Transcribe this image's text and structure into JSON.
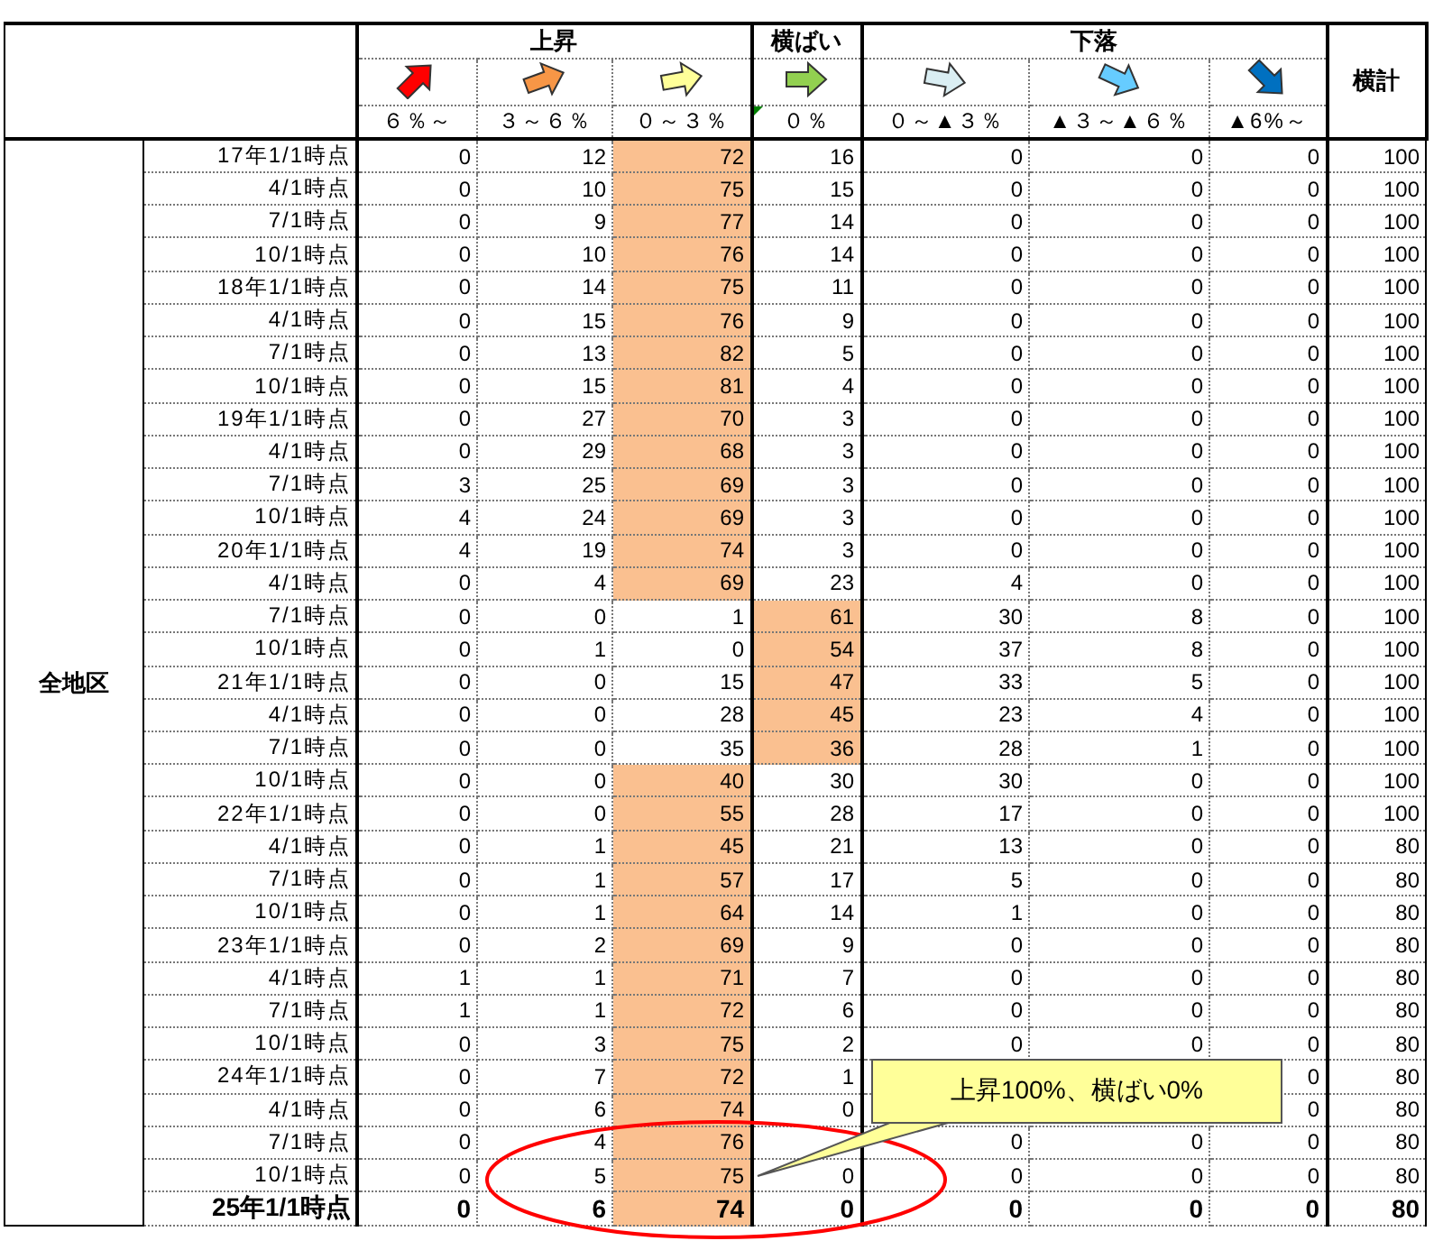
{
  "groups": [
    {
      "label": "上昇",
      "columns": [
        {
          "label": "６％～",
          "color": "#ff0000"
        },
        {
          "label": "３～６％",
          "color": "#f79646"
        },
        {
          "label": "０～３％",
          "color": "#ffff99"
        }
      ]
    },
    {
      "label": "横ばい",
      "columns": [
        {
          "label": "０％",
          "color": "#92d050"
        }
      ]
    },
    {
      "label": "下落",
      "columns": [
        {
          "label": "０～▲３％",
          "color": "#daeef3"
        },
        {
          "label": "▲３～▲６％",
          "color": "#66ccff"
        },
        {
          "label": "▲6%～",
          "color": "#0070c0"
        }
      ]
    }
  ],
  "total_header": "横計",
  "region": "全地区",
  "rows": [
    {
      "label": "17年1/1時点",
      "values": [
        "0",
        "12",
        "72",
        "16",
        "0",
        "0",
        "0"
      ],
      "total": "100",
      "flat_highlighted": false,
      "emphasis": false,
      "kind": "full"
    },
    {
      "label": "4/1時点",
      "values": [
        "0",
        "10",
        "75",
        "15",
        "0",
        "0",
        "0"
      ],
      "total": "100",
      "flat_highlighted": false,
      "emphasis": false,
      "kind": "full"
    },
    {
      "label": "7/1時点",
      "values": [
        "0",
        "9",
        "77",
        "14",
        "0",
        "0",
        "0"
      ],
      "total": "100",
      "flat_highlighted": false,
      "emphasis": false,
      "kind": "full"
    },
    {
      "label": "10/1時点",
      "values": [
        "0",
        "10",
        "76",
        "14",
        "0",
        "0",
        "0"
      ],
      "total": "100",
      "flat_highlighted": false,
      "emphasis": false,
      "kind": "full"
    },
    {
      "label": "18年1/1時点",
      "values": [
        "0",
        "14",
        "75",
        "11",
        "0",
        "0",
        "0"
      ],
      "total": "100",
      "flat_highlighted": false,
      "emphasis": false,
      "kind": "full"
    },
    {
      "label": "4/1時点",
      "values": [
        "0",
        "15",
        "76",
        "9",
        "0",
        "0",
        "0"
      ],
      "total": "100",
      "flat_highlighted": false,
      "emphasis": false,
      "kind": "full"
    },
    {
      "label": "7/1時点",
      "values": [
        "0",
        "13",
        "82",
        "5",
        "0",
        "0",
        "0"
      ],
      "total": "100",
      "flat_highlighted": false,
      "emphasis": false,
      "kind": "full"
    },
    {
      "label": "10/1時点",
      "values": [
        "0",
        "15",
        "81",
        "4",
        "0",
        "0",
        "0"
      ],
      "total": "100",
      "flat_highlighted": false,
      "emphasis": false,
      "kind": "full"
    },
    {
      "label": "19年1/1時点",
      "values": [
        "0",
        "27",
        "70",
        "3",
        "0",
        "0",
        "0"
      ],
      "total": "100",
      "flat_highlighted": false,
      "emphasis": false,
      "kind": "full"
    },
    {
      "label": "4/1時点",
      "values": [
        "0",
        "29",
        "68",
        "3",
        "0",
        "0",
        "0"
      ],
      "total": "100",
      "flat_highlighted": false,
      "emphasis": false,
      "kind": "full"
    },
    {
      "label": "7/1時点",
      "values": [
        "3",
        "25",
        "69",
        "3",
        "0",
        "0",
        "0"
      ],
      "total": "100",
      "flat_highlighted": false,
      "emphasis": false,
      "kind": "full"
    },
    {
      "label": "10/1時点",
      "values": [
        "4",
        "24",
        "69",
        "3",
        "0",
        "0",
        "0"
      ],
      "total": "100",
      "flat_highlighted": false,
      "emphasis": false,
      "kind": "full"
    },
    {
      "label": "20年1/1時点",
      "values": [
        "4",
        "19",
        "74",
        "3",
        "0",
        "0",
        "0"
      ],
      "total": "100",
      "flat_highlighted": false,
      "emphasis": false,
      "kind": "full"
    },
    {
      "label": "4/1時点",
      "values": [
        "0",
        "4",
        "69",
        "23",
        "4",
        "0",
        "0"
      ],
      "total": "100",
      "flat_highlighted": false,
      "emphasis": false,
      "kind": "full"
    },
    {
      "label": "7/1時点",
      "values": [
        "0",
        "0",
        "1",
        "61",
        "30",
        "8",
        "0"
      ],
      "total": "100",
      "flat_highlighted": true,
      "emphasis": false,
      "kind": "full"
    },
    {
      "label": "10/1時点",
      "values": [
        "0",
        "1",
        "0",
        "54",
        "37",
        "8",
        "0"
      ],
      "total": "100",
      "flat_highlighted": true,
      "emphasis": false,
      "kind": "full"
    },
    {
      "label": "21年1/1時点",
      "values": [
        "0",
        "0",
        "15",
        "47",
        "33",
        "5",
        "0"
      ],
      "total": "100",
      "flat_highlighted": true,
      "emphasis": false,
      "kind": "full"
    },
    {
      "label": "4/1時点",
      "values": [
        "0",
        "0",
        "28",
        "45",
        "23",
        "4",
        "0"
      ],
      "total": "100",
      "flat_highlighted": true,
      "emphasis": false,
      "kind": "full"
    },
    {
      "label": "7/1時点",
      "values": [
        "0",
        "0",
        "35",
        "36",
        "28",
        "1",
        "0"
      ],
      "total": "100",
      "flat_highlighted": true,
      "emphasis": false,
      "kind": "full"
    },
    {
      "label": "10/1時点",
      "values": [
        "0",
        "0",
        "40",
        "30",
        "30",
        "0",
        "0"
      ],
      "total": "100",
      "flat_highlighted": false,
      "emphasis": false,
      "kind": "full"
    },
    {
      "label": "22年1/1時点",
      "values": [
        "0",
        "0",
        "55",
        "28",
        "17",
        "0",
        "0"
      ],
      "total": "100",
      "flat_highlighted": false,
      "emphasis": false,
      "kind": "full"
    },
    {
      "label": "4/1時点",
      "values": [
        "0",
        "1",
        "45",
        "21",
        "13",
        "0",
        "0"
      ],
      "total": "80",
      "flat_highlighted": false,
      "emphasis": false,
      "kind": "full"
    },
    {
      "label": "7/1時点",
      "values": [
        "0",
        "1",
        "57",
        "17",
        "5",
        "0",
        "0"
      ],
      "total": "80",
      "flat_highlighted": false,
      "emphasis": false,
      "kind": "full"
    },
    {
      "label": "10/1時点",
      "values": [
        "0",
        "1",
        "64",
        "14",
        "1",
        "0",
        "0"
      ],
      "total": "80",
      "flat_highlighted": false,
      "emphasis": false,
      "kind": "full"
    },
    {
      "label": "23年1/1時点",
      "values": [
        "0",
        "2",
        "69",
        "9",
        "0",
        "0",
        "0"
      ],
      "total": "80",
      "flat_highlighted": false,
      "emphasis": false,
      "kind": "full"
    },
    {
      "label": "4/1時点",
      "values": [
        "1",
        "1",
        "71",
        "7",
        "0",
        "0",
        "0"
      ],
      "total": "80",
      "flat_highlighted": false,
      "emphasis": false,
      "kind": "full"
    },
    {
      "label": "7/1時点",
      "values": [
        "1",
        "1",
        "72",
        "6",
        "0",
        "0",
        "0"
      ],
      "total": "80",
      "flat_highlighted": false,
      "emphasis": false,
      "kind": "full"
    },
    {
      "label": "10/1時点",
      "values": [
        "0",
        "3",
        "75",
        "2",
        "0",
        "0",
        "0"
      ],
      "total": "80",
      "flat_highlighted": false,
      "emphasis": false,
      "kind": "full"
    },
    {
      "label": "24年1/1時点",
      "values": [
        "0",
        "7",
        "72",
        "1",
        "0"
      ],
      "total": "80",
      "flat_highlighted": false,
      "emphasis": false,
      "kind": "under-callout"
    },
    {
      "label": "4/1時点",
      "values": [
        "0",
        "6",
        "74",
        "0",
        "0"
      ],
      "total": "80",
      "flat_highlighted": false,
      "emphasis": false,
      "kind": "under-callout"
    },
    {
      "label": "7/1時点",
      "values": [
        "0",
        "4",
        "76",
        "0",
        "0",
        "0"
      ],
      "total": "80",
      "flat_highlighted": false,
      "emphasis": false,
      "kind": "under-pointer"
    },
    {
      "label": "10/1時点",
      "values": [
        "0",
        "5",
        "75",
        "0",
        "0",
        "0",
        "0"
      ],
      "total": "80",
      "flat_highlighted": false,
      "emphasis": false,
      "kind": "full"
    },
    {
      "label": "25年1/1時点",
      "values": [
        "0",
        "6",
        "74",
        "0",
        "0",
        "0",
        "0"
      ],
      "total": "80",
      "flat_highlighted": false,
      "emphasis": true,
      "kind": "full"
    }
  ],
  "callout": {
    "text": "上昇100%、横ばい0%"
  }
}
